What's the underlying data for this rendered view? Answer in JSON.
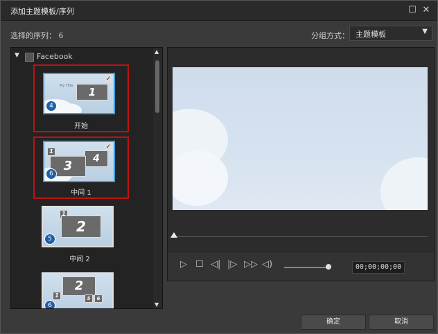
{
  "window": {
    "title": "添加主题模板/序列",
    "maximize_icon": "☐",
    "close_icon": "✕"
  },
  "top": {
    "selected_label": "选择的序列： 6",
    "group_label": "分组方式：",
    "group_value": "主题模板",
    "dropdown_arrow": "▼"
  },
  "list": {
    "group_name": "Facebook",
    "items": [
      {
        "caption": "开始",
        "badge": "4",
        "slide_num": "1",
        "slide_text": "My Title",
        "selected": true,
        "checked": true
      },
      {
        "caption": "中间 1",
        "badge": "6",
        "slide_num": "3",
        "slide_num2": "4",
        "slide_num3": "1",
        "selected": true,
        "checked": true
      },
      {
        "caption": "中间 2",
        "badge": "5",
        "slide_num": "2",
        "slide_num2": "1",
        "selected": false,
        "checked": false
      },
      {
        "caption": "",
        "badge": "6",
        "slide_num": "2",
        "slide_num2": "1",
        "slide_num3": "5",
        "slide_num4": "6",
        "selected": false,
        "checked": false
      }
    ]
  },
  "player": {
    "timecode": "00;00;00;00"
  },
  "buttons": {
    "ok": "确定",
    "cancel": "取消"
  },
  "colors": {
    "selection": "#c01212",
    "accent": "#3aa0dc",
    "badge": "#1f5fa8"
  }
}
